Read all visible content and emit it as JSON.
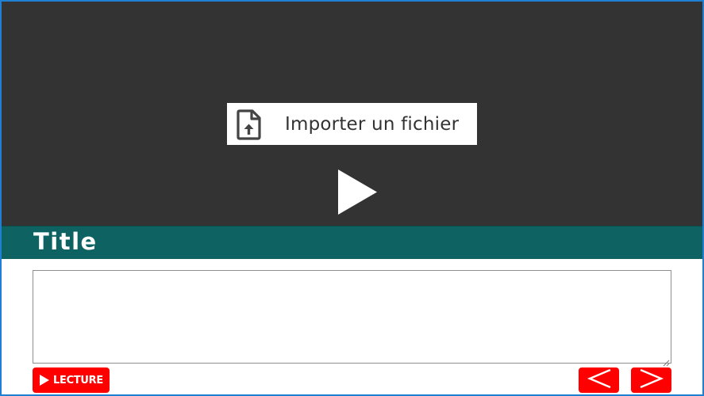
{
  "player": {
    "upload_label": "Importer un fichier",
    "upload_icon": "file-upload-icon",
    "play_icon": "play-icon"
  },
  "title_bar": {
    "title": "Title",
    "background": "#0f6262"
  },
  "text_area": {
    "value": ""
  },
  "controls": {
    "lecture_label": "LECTURE",
    "lecture_icon": "play-triangle-icon",
    "prev_icon": "chevron-left-icon",
    "next_icon": "chevron-right-icon",
    "accent": "#ff0000"
  }
}
